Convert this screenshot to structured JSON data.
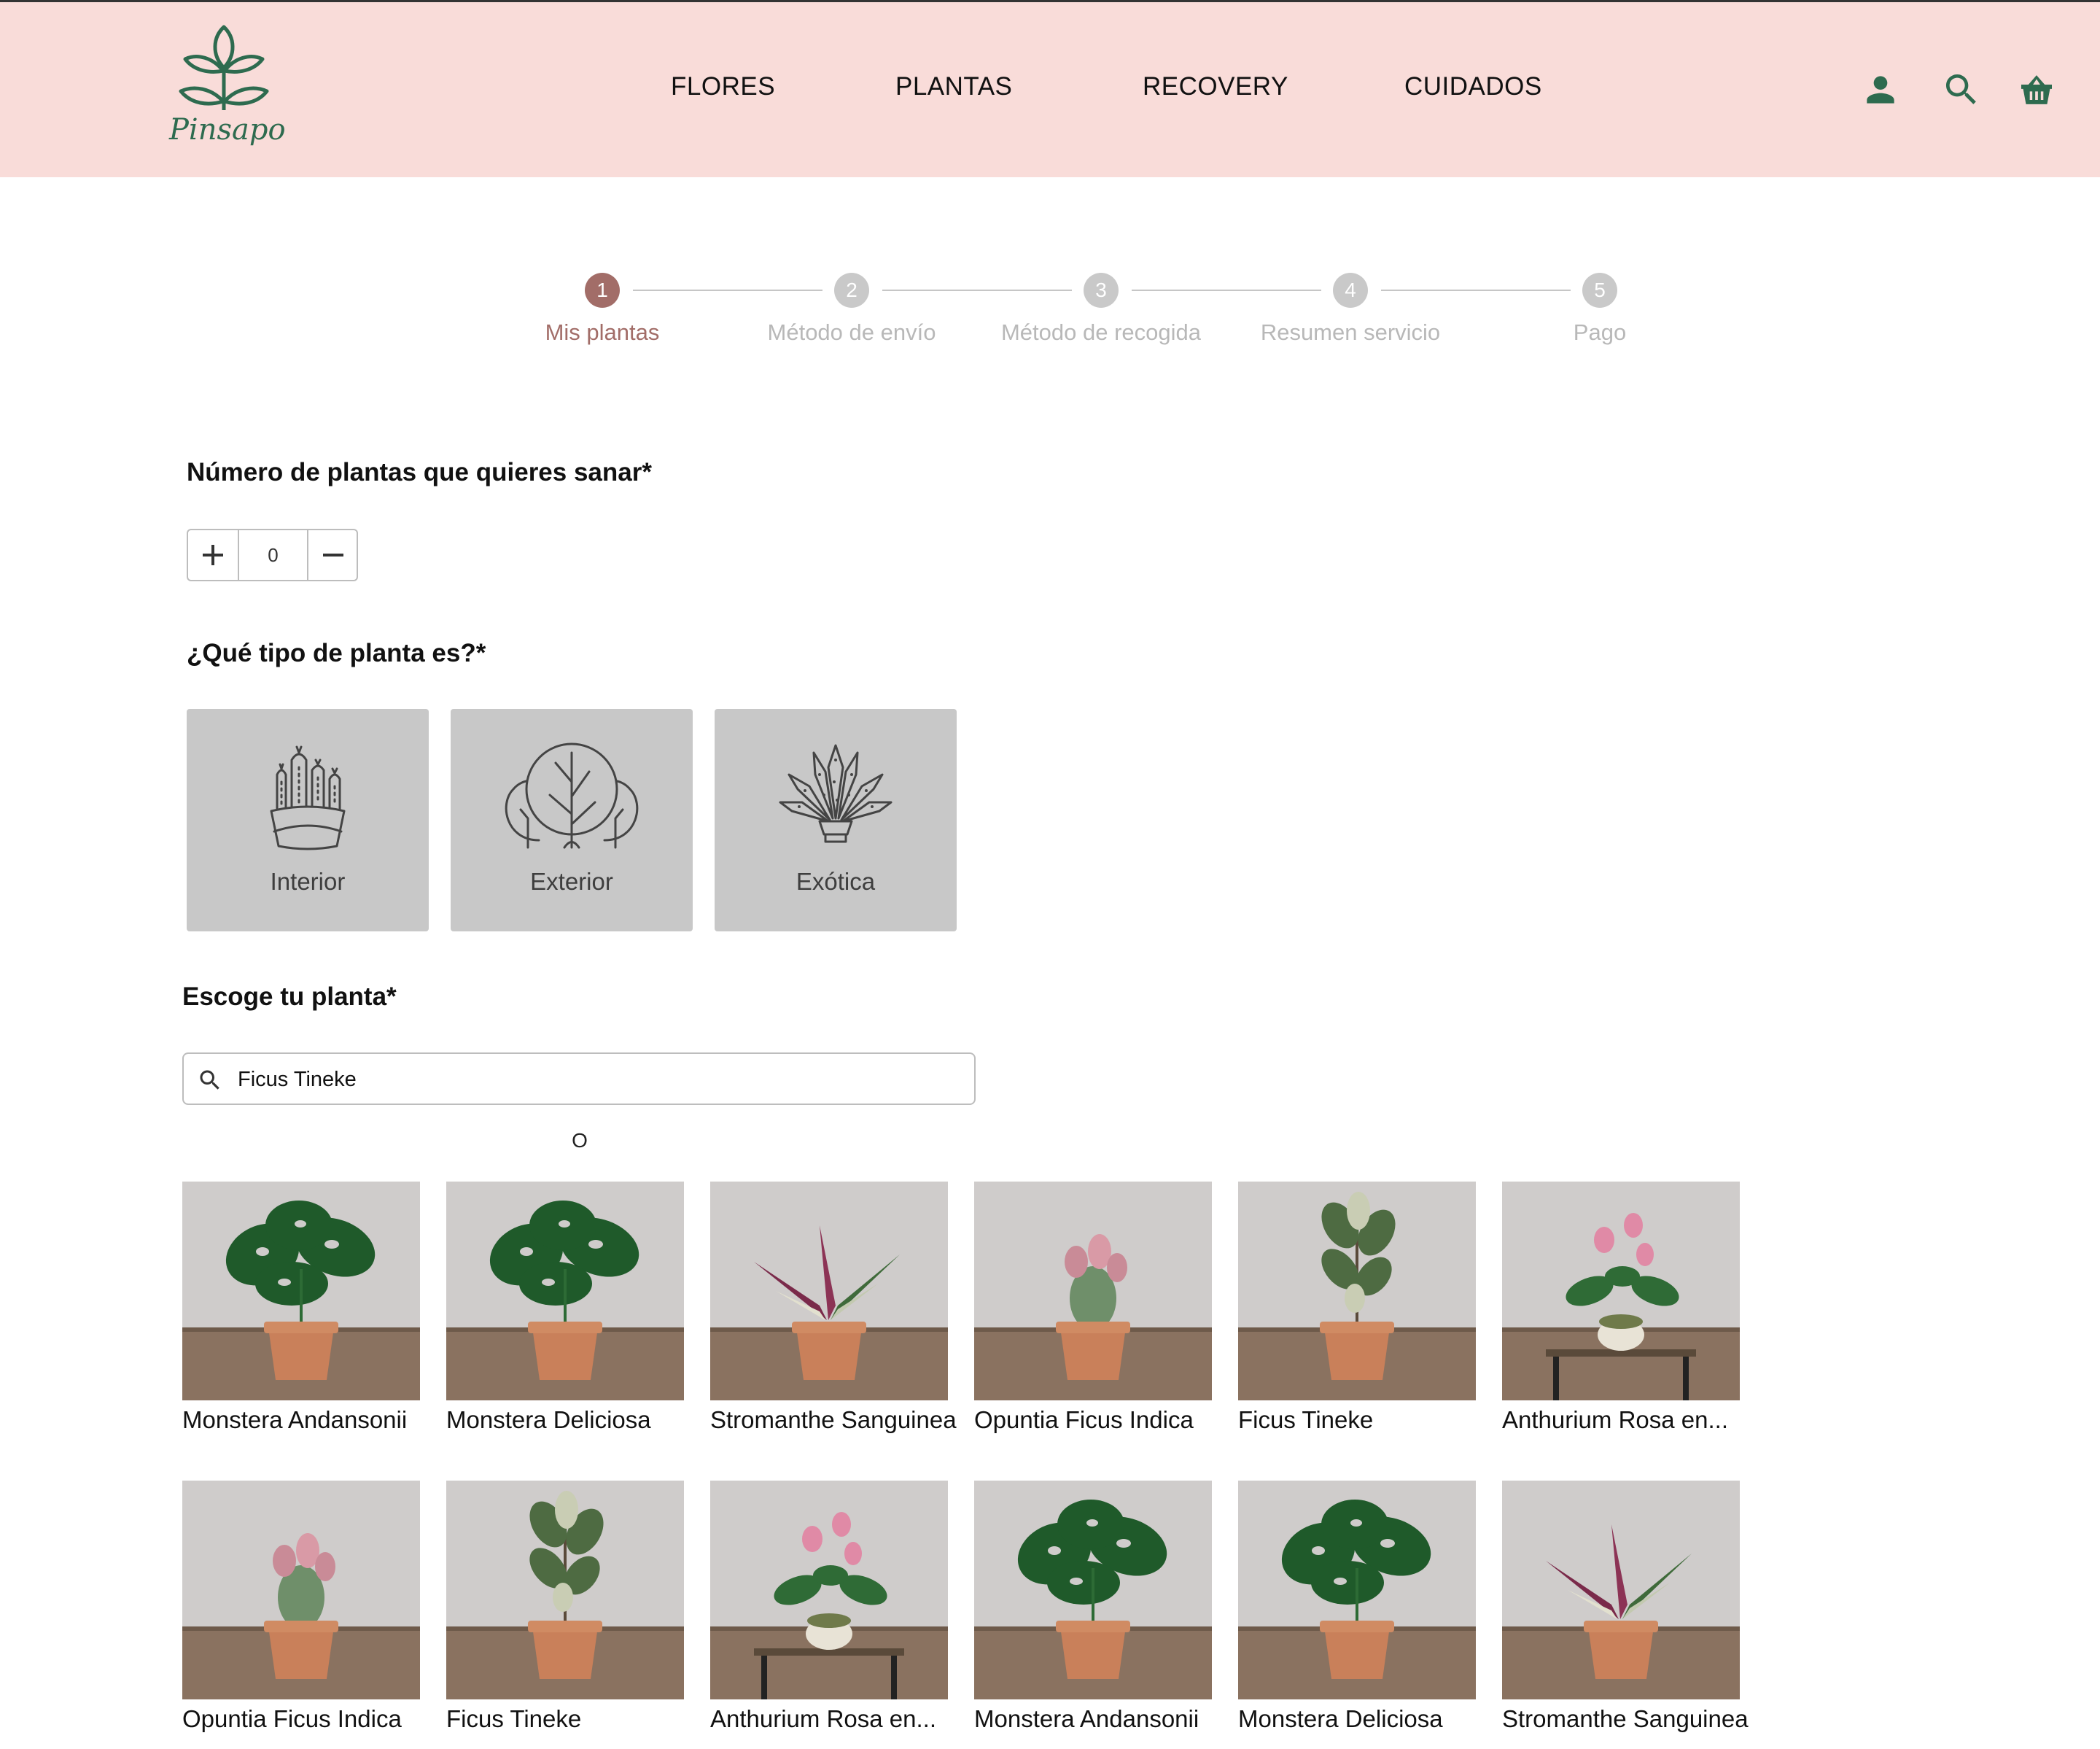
{
  "brand": {
    "name": "Pinsapo",
    "color": "#2e6b4f"
  },
  "nav": [
    "FLORES",
    "PLANTAS",
    "RECOVERY",
    "CUIDADOS"
  ],
  "header_icons": [
    "user-icon",
    "search-icon",
    "basket-icon"
  ],
  "colors": {
    "header_bg": "#f9dcd9",
    "accent": "#a26d68",
    "inactive": "#c9c9c9",
    "card_bg": "#c8c8c8"
  },
  "steps": [
    {
      "number": "1",
      "label": "Mis plantas",
      "active": true
    },
    {
      "number": "2",
      "label": "Método de envío",
      "active": false
    },
    {
      "number": "3",
      "label": "Método de recogida",
      "active": false
    },
    {
      "number": "4",
      "label": "Resumen servicio",
      "active": false
    },
    {
      "number": "5",
      "label": "Pago",
      "active": false
    }
  ],
  "quantity": {
    "title": "Número de plantas que quieres sanar*",
    "value": "0"
  },
  "plant_type": {
    "title": "¿Qué tipo de planta es?*",
    "options": [
      {
        "label": "Interior",
        "icon": "cactus-pot-icon"
      },
      {
        "label": "Exterior",
        "icon": "trees-icon"
      },
      {
        "label": "Exótica",
        "icon": "succulent-icon"
      }
    ]
  },
  "choose_plant": {
    "title": "Escoge tu planta*",
    "search_value": "Ficus Tineke",
    "or_text": "O"
  },
  "plants": [
    "Monstera Andansonii",
    "Monstera Deliciosa",
    "Stromanthe Sanguinea",
    "Opuntia Ficus Indica",
    "Ficus Tineke",
    "Anthurium Rosa en...",
    "Opuntia Ficus Indica",
    "Ficus Tineke",
    "Anthurium Rosa en...",
    "Monstera Andansonii",
    "Monstera Deliciosa",
    "Stromanthe Sanguinea"
  ]
}
